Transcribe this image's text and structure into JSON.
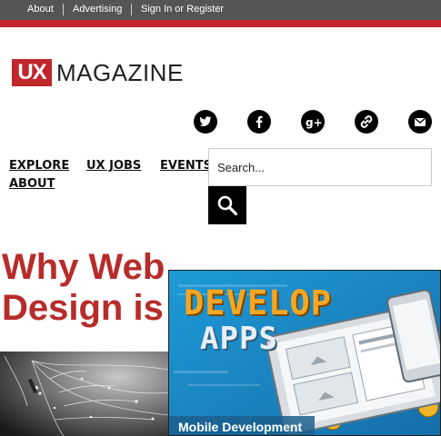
{
  "topbar": {
    "links": [
      "About",
      "Advertising",
      "Sign In or Register"
    ]
  },
  "logo": {
    "ux": "UX",
    "name": "MAGAZINE"
  },
  "social": [
    "twitter-icon",
    "facebook-icon",
    "google-plus-icon",
    "link-icon",
    "email-icon"
  ],
  "nav": {
    "items": [
      "EXPLORE",
      "UX JOBS",
      "EVENTS",
      "ABOUT"
    ]
  },
  "search": {
    "placeholder": "Search..."
  },
  "article": {
    "headline_line1": "Why Web",
    "headline_line2": "Design is D"
  },
  "ad": {
    "title1": "DEVELOP",
    "title2": "APPS",
    "subtitle": "Mobile Development"
  },
  "colors": {
    "brand_red": "#c1272d",
    "headline_red": "#b72c2a",
    "topbar_gray": "#555555",
    "ad_blue": "#1c8fd0"
  }
}
